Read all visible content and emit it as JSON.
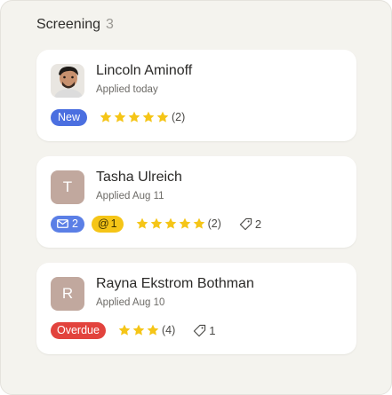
{
  "column": {
    "title": "Screening",
    "count": "3"
  },
  "cards": [
    {
      "name": "Lincoln Aminoff",
      "applied": "Applied today",
      "avatar": "photo",
      "badge": "New",
      "rating_count": "(2)"
    },
    {
      "name": "Tasha Ulreich",
      "applied": "Applied Aug 11",
      "avatar_letter": "T",
      "mail_count": "2",
      "mention_count": "1",
      "rating_count": "(2)",
      "tag_count": "2"
    },
    {
      "name": "Rayna Ekstrom Bothman",
      "applied": "Applied Aug 10",
      "avatar_letter": "R",
      "badge": "Overdue",
      "rating_count": "(4)",
      "tag_count": "1"
    }
  ],
  "colors": {
    "star": "#f5c517",
    "new_badge": "#4b6fe0",
    "overdue_badge": "#e2433d",
    "mail_badge": "#5b7fe6",
    "mention_badge": "#f5c517",
    "avatar_letter_bg": "#c1a89e"
  },
  "icons": {
    "star": "star-icon",
    "mail": "mail-icon",
    "mention": "at-icon",
    "tag": "tag-icon"
  }
}
